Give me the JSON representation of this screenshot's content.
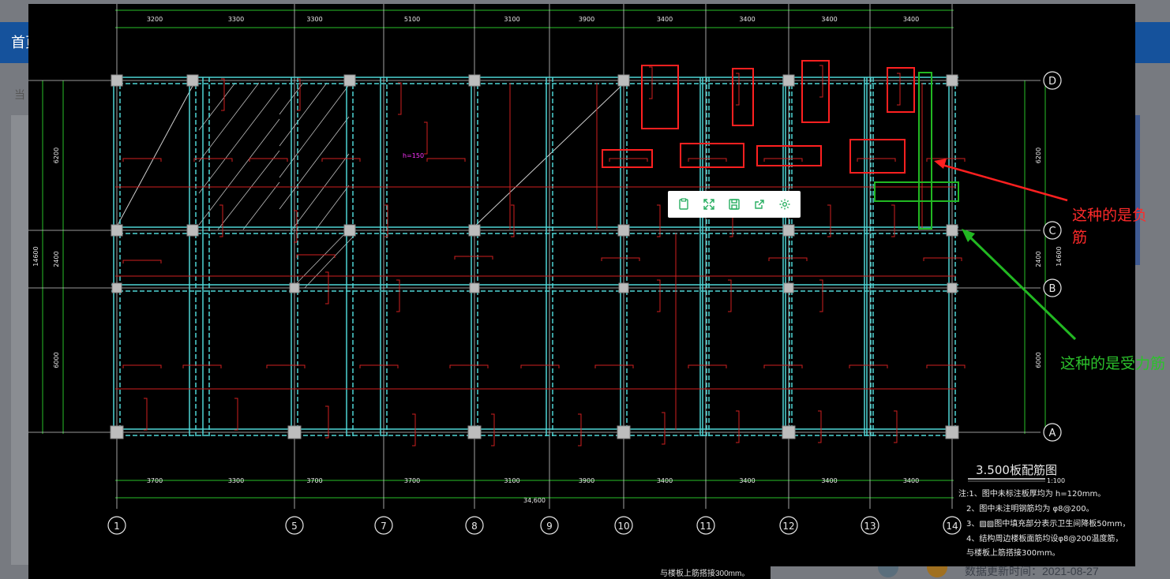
{
  "background_page": {
    "nav_home": "首页",
    "breadcrumb": "当",
    "data_update": "数据更新时间：2021-08-27",
    "footer_snippet": "与楼板上筋搭接300mm。"
  },
  "drawing": {
    "title": "3.500板配筋图",
    "scale": "1:100",
    "top_dims": [
      "3200",
      "3300",
      "3300",
      "5100",
      "3100",
      "3900",
      "3400",
      "3400",
      "3400",
      "3400"
    ],
    "bottom_dims": [
      "3700",
      "3300",
      "3700",
      "3700",
      "3100",
      "3900",
      "3400",
      "3400",
      "3400",
      "3400"
    ],
    "total_dim": "34,600",
    "left_dims": [
      "6200",
      "2400",
      "6000"
    ],
    "left_total": "14600",
    "right_dims": [
      "6200",
      "2400",
      "6000"
    ],
    "right_total": "14600",
    "row_axes": [
      "D",
      "C",
      "B",
      "A"
    ],
    "col_axes": [
      "1",
      "5",
      "7",
      "8",
      "9",
      "10",
      "11",
      "12",
      "13",
      "14"
    ],
    "notes": [
      "注:1、图中未标注板厚均为 h=120mm。",
      "2、图中未注明钢筋均为 φ8@200。",
      "3、▨▨图中填充部分表示卫生间降板50mm，",
      "4、结构周边楼板面筋均设φ8@200温度筋，",
      "与楼板上筋搭接300mm。"
    ],
    "h_label": "h=150"
  },
  "annotations": {
    "red_note": "这种的是负筋",
    "green_note": "这种的是受力筋"
  },
  "toolbar": {
    "icons": [
      "clipboard-icon",
      "expand-icon",
      "save-icon",
      "share-icon",
      "settings-icon"
    ]
  },
  "colors": {
    "navbar": "#15529c",
    "cad_bg": "#000000",
    "beam": "#4fd6d6",
    "dim": "#27c127",
    "rebar": "#d11f1f",
    "highlight_red": "#ff2020",
    "highlight_green": "#22b822"
  }
}
